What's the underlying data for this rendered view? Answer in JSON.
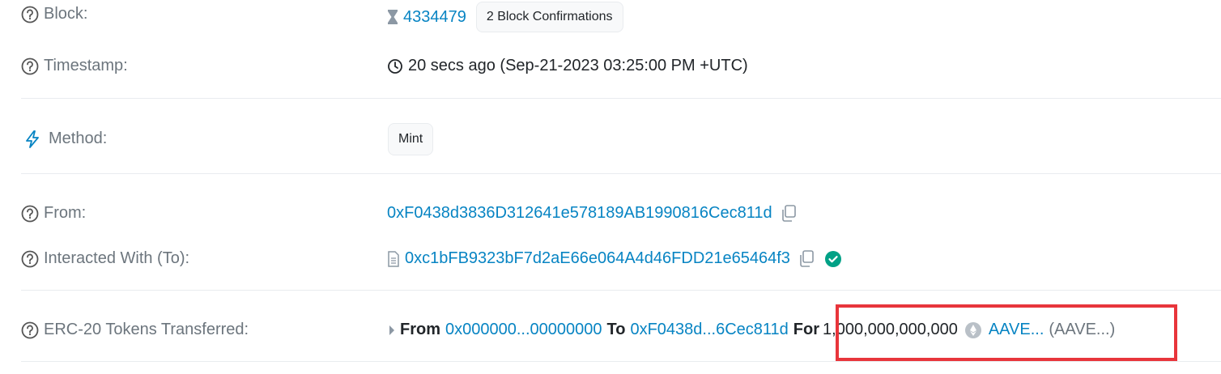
{
  "block": {
    "label": "Block:",
    "number": "4334479",
    "confirmations": "2 Block Confirmations"
  },
  "timestamp": {
    "label": "Timestamp:",
    "value": "20 secs ago (Sep-21-2023 03:25:00 PM +UTC)"
  },
  "method": {
    "label": "Method:",
    "value": "Mint"
  },
  "from": {
    "label": "From:",
    "address": "0xF0438d3836D312641e578189AB1990816Cec811d"
  },
  "interacted": {
    "label": "Interacted With (To):",
    "address": "0xc1bFB9323bF7d2aE66e064A4d46FDD21e65464f3"
  },
  "erc20": {
    "label": "ERC-20 Tokens Transferred:",
    "from_word": "From",
    "from_addr": "0x000000...00000000",
    "to_word": "To",
    "to_addr": "0xF0438d...6Cec811d",
    "for_word": "For",
    "amount": "1,000,000,000,000",
    "token_name": "AAVE...",
    "token_symbol": "(AAVE...)"
  },
  "colors": {
    "link": "#0784c3",
    "label": "#6c757d",
    "verified": "#00a186",
    "highlight": "#e8353b"
  }
}
